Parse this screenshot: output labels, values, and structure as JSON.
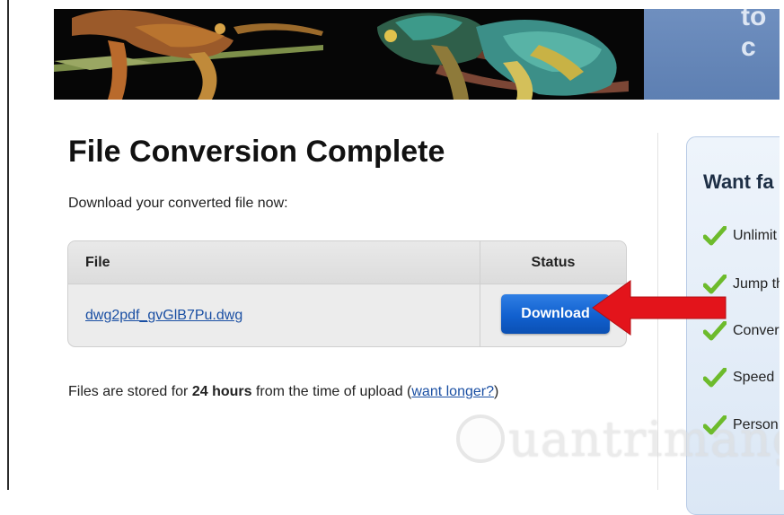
{
  "banner": {
    "right_text": "to c"
  },
  "page": {
    "title": "File Conversion Complete",
    "subtitle": "Download your converted file now:"
  },
  "table": {
    "columns": [
      "File",
      "Status"
    ],
    "rows": [
      {
        "file": "dwg2pdf_gvGlB7Pu.dwg",
        "status_button": "Download"
      }
    ]
  },
  "storage_note": {
    "prefix": "Files are stored for ",
    "bold": "24 hours",
    "middle": " from the time of upload (",
    "link": "want longer?",
    "suffix": ")"
  },
  "sidebar": {
    "title": "Want fa",
    "items": [
      {
        "label": "Unlimit",
        "icon": "check-icon"
      },
      {
        "label": "Jump th",
        "icon": "check-icon"
      },
      {
        "label": "Conver",
        "icon": "check-icon"
      },
      {
        "label": "Speed",
        "icon": "check-icon"
      },
      {
        "label": "Person",
        "icon": "check-icon"
      }
    ]
  },
  "watermark": {
    "text": "uantrimang"
  },
  "colors": {
    "accent": "#1160cf",
    "link": "#1a4fa3",
    "check": "#6dbb2c",
    "arrow": "#e3141b"
  }
}
